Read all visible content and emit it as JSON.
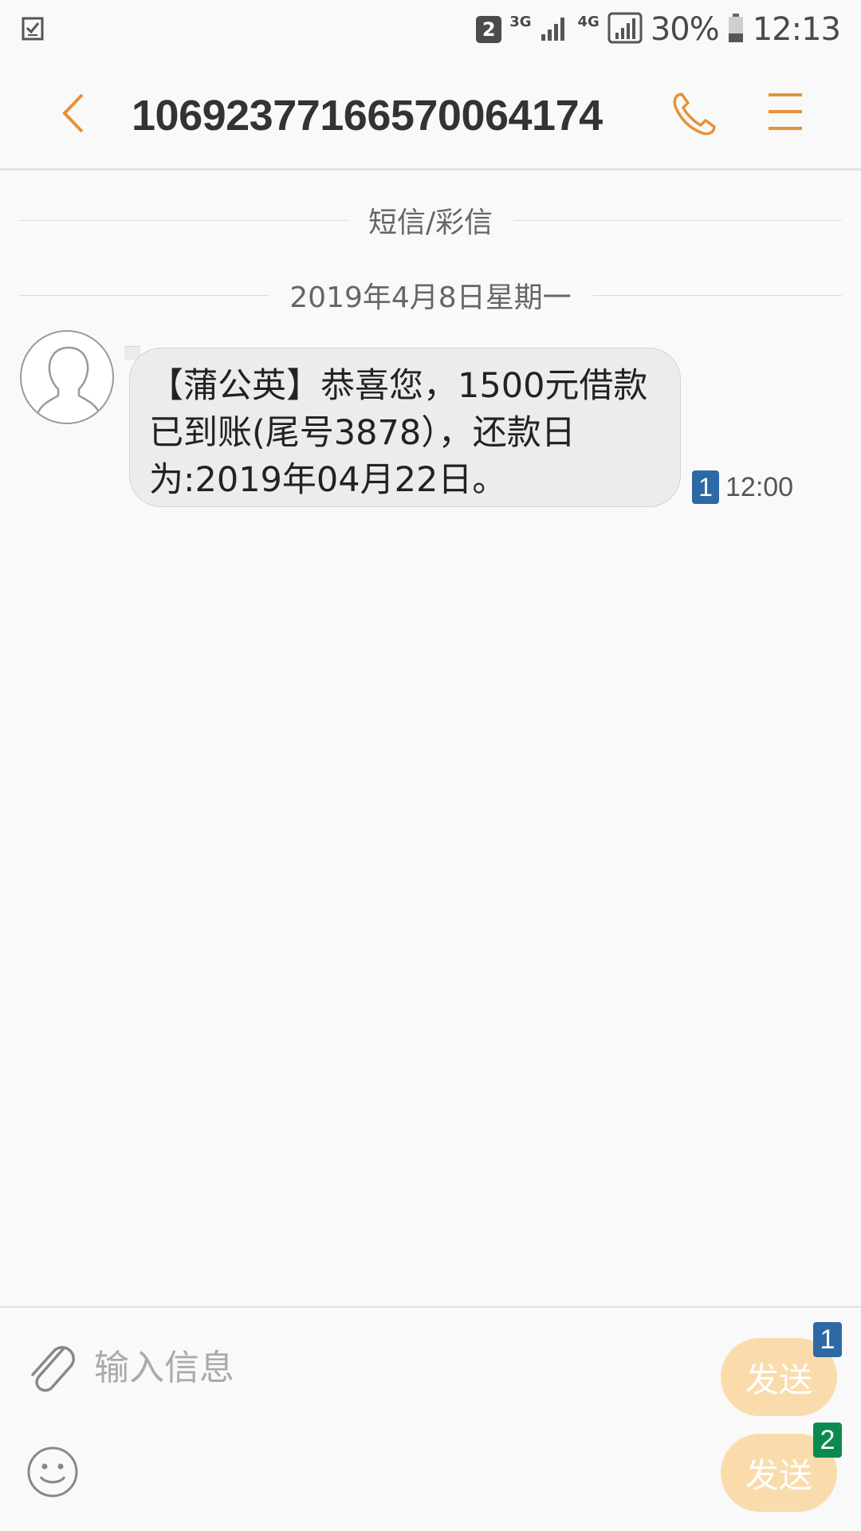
{
  "status_bar": {
    "sim_badge": "2",
    "network_1": "3G",
    "network_2": "4G",
    "battery": "30%",
    "time": "12:13"
  },
  "header": {
    "title": "10692377166570064174"
  },
  "conversation": {
    "channel_label": "短信/彩信",
    "date_label": "2019年4月8日星期一",
    "messages": [
      {
        "text": "【蒲公英】恭喜您，1500元借款已到账(尾号3878），还款日为:2019年04月22日。",
        "sim": "1",
        "time": "12:00"
      }
    ]
  },
  "composer": {
    "placeholder": "输入信息",
    "send_label_1": "发送",
    "send_label_2": "发送",
    "sim_1": "1",
    "sim_2": "2"
  },
  "colors": {
    "accent_orange": "#e8913a",
    "sim1_blue": "#2d6aa5",
    "sim2_green": "#0b8a4f",
    "send_button": "#fadcac",
    "bubble": "#ececec"
  },
  "icons": {
    "status_left": "checklist-icon",
    "back": "chevron-left-icon",
    "call": "phone-icon",
    "menu": "menu-icon",
    "avatar": "person-avatar-icon",
    "attach": "paperclip-icon",
    "emoji": "smiley-icon"
  }
}
